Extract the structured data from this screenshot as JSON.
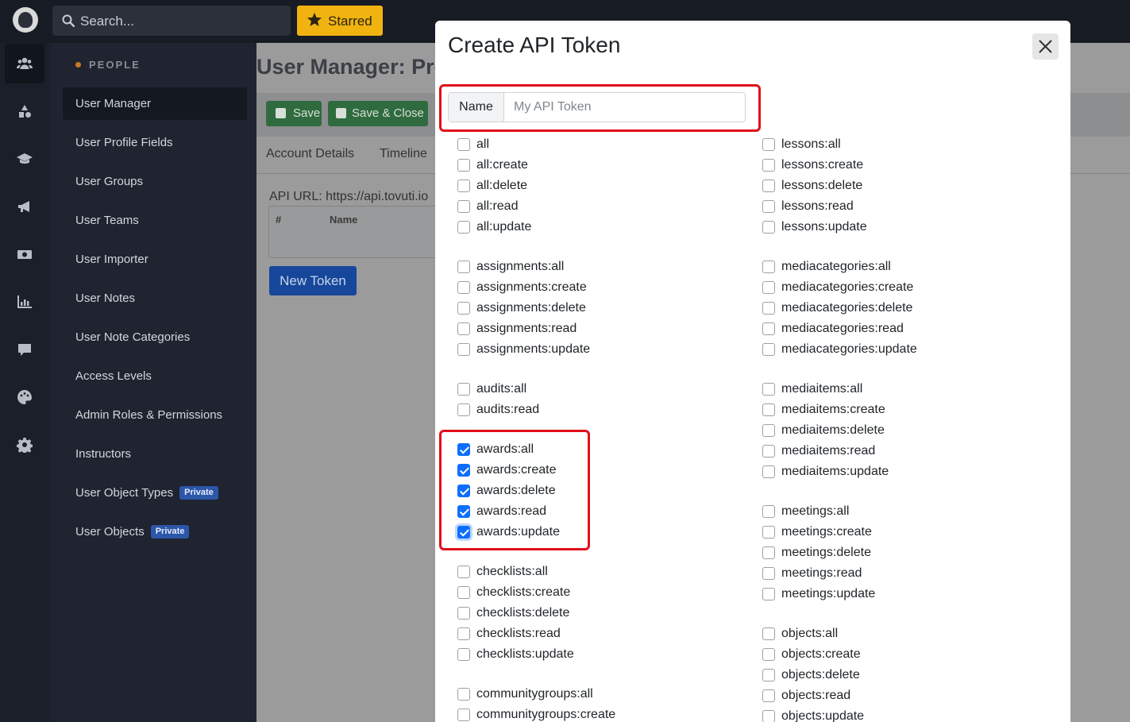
{
  "topbar": {
    "search_placeholder": "Search...",
    "starred_label": "Starred"
  },
  "rail": {
    "icons": [
      "users-icon",
      "shapes-icon",
      "graduation-cap-icon",
      "megaphone-icon",
      "money-icon",
      "chart-icon",
      "comment-icon",
      "palette-icon",
      "gear-icon"
    ]
  },
  "sidebar": {
    "section": "PEOPLE",
    "items": [
      {
        "label": "User Manager"
      },
      {
        "label": "User Profile Fields"
      },
      {
        "label": "User Groups"
      },
      {
        "label": "User Teams"
      },
      {
        "label": "User Importer"
      },
      {
        "label": "User Notes"
      },
      {
        "label": "User Note Categories"
      },
      {
        "label": "Access Levels"
      },
      {
        "label": "Admin Roles & Permissions"
      },
      {
        "label": "Instructors"
      },
      {
        "label": "User Object Types",
        "badge": "Private"
      },
      {
        "label": "User Objects",
        "badge": "Private"
      }
    ]
  },
  "main": {
    "title": "User Manager: Profi",
    "save_label": "Save",
    "save_close_label": "Save & Close",
    "tabs": [
      "Account Details",
      "Timeline"
    ],
    "api_url": "API URL: https://api.tovuti.io",
    "table_headers": [
      "#",
      "Name"
    ],
    "new_token_label": "New Token"
  },
  "modal": {
    "title": "Create API Token",
    "name_label": "Name",
    "name_placeholder": "My API Token",
    "left_groups": [
      [
        {
          "label": "all",
          "checked": false
        },
        {
          "label": "all:create",
          "checked": false
        },
        {
          "label": "all:delete",
          "checked": false
        },
        {
          "label": "all:read",
          "checked": false
        },
        {
          "label": "all:update",
          "checked": false
        }
      ],
      [
        {
          "label": "assignments:all",
          "checked": false
        },
        {
          "label": "assignments:create",
          "checked": false
        },
        {
          "label": "assignments:delete",
          "checked": false
        },
        {
          "label": "assignments:read",
          "checked": false
        },
        {
          "label": "assignments:update",
          "checked": false
        }
      ],
      [
        {
          "label": "audits:all",
          "checked": false
        },
        {
          "label": "audits:read",
          "checked": false
        }
      ],
      [
        {
          "label": "awards:all",
          "checked": true
        },
        {
          "label": "awards:create",
          "checked": true
        },
        {
          "label": "awards:delete",
          "checked": true
        },
        {
          "label": "awards:read",
          "checked": true
        },
        {
          "label": "awards:update",
          "checked": true,
          "focused": true
        }
      ],
      [
        {
          "label": "checklists:all",
          "checked": false
        },
        {
          "label": "checklists:create",
          "checked": false
        },
        {
          "label": "checklists:delete",
          "checked": false
        },
        {
          "label": "checklists:read",
          "checked": false
        },
        {
          "label": "checklists:update",
          "checked": false
        }
      ],
      [
        {
          "label": "communitygroups:all",
          "checked": false
        },
        {
          "label": "communitygroups:create",
          "checked": false
        }
      ]
    ],
    "right_groups": [
      [
        {
          "label": "lessons:all",
          "checked": false
        },
        {
          "label": "lessons:create",
          "checked": false
        },
        {
          "label": "lessons:delete",
          "checked": false
        },
        {
          "label": "lessons:read",
          "checked": false
        },
        {
          "label": "lessons:update",
          "checked": false
        }
      ],
      [
        {
          "label": "mediacategories:all",
          "checked": false
        },
        {
          "label": "mediacategories:create",
          "checked": false
        },
        {
          "label": "mediacategories:delete",
          "checked": false
        },
        {
          "label": "mediacategories:read",
          "checked": false
        },
        {
          "label": "mediacategories:update",
          "checked": false
        }
      ],
      [
        {
          "label": "mediaitems:all",
          "checked": false
        },
        {
          "label": "mediaitems:create",
          "checked": false
        },
        {
          "label": "mediaitems:delete",
          "checked": false
        },
        {
          "label": "mediaitems:read",
          "checked": false
        },
        {
          "label": "mediaitems:update",
          "checked": false
        }
      ],
      [
        {
          "label": "meetings:all",
          "checked": false
        },
        {
          "label": "meetings:create",
          "checked": false
        },
        {
          "label": "meetings:delete",
          "checked": false
        },
        {
          "label": "meetings:read",
          "checked": false
        },
        {
          "label": "meetings:update",
          "checked": false
        }
      ],
      [
        {
          "label": "objects:all",
          "checked": false
        },
        {
          "label": "objects:create",
          "checked": false
        },
        {
          "label": "objects:delete",
          "checked": false
        },
        {
          "label": "objects:read",
          "checked": false
        },
        {
          "label": "objects:update",
          "checked": false
        }
      ]
    ]
  },
  "colors": {
    "highlight": "#e0101a",
    "checkbox_accent": "#0d6efd",
    "starred": "#f0b310",
    "save_green": "#2f6b3e"
  }
}
